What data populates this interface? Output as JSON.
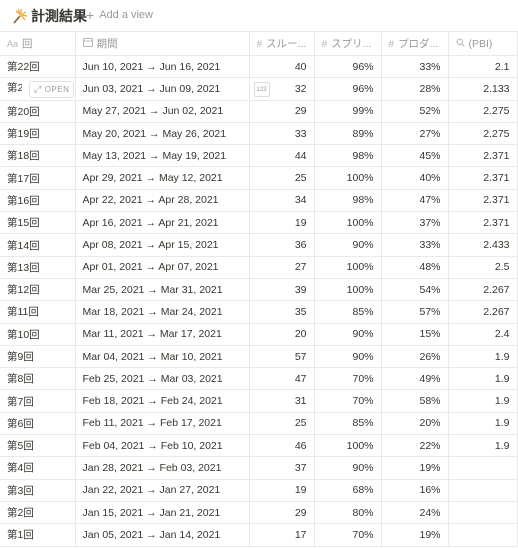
{
  "database": {
    "title": "計測結果",
    "icon": "sparkler-icon",
    "add_view_label": "Add a view"
  },
  "columns": [
    {
      "label": "回",
      "icon": "title-aa-icon"
    },
    {
      "label": "期間",
      "icon": "calendar-icon"
    },
    {
      "label": "スルー...",
      "icon": "number-hash-icon"
    },
    {
      "label": "スプリ...",
      "icon": "number-hash-icon"
    },
    {
      "label": "プロダ...",
      "icon": "number-hash-icon"
    },
    {
      "label": "(PBI)",
      "icon": "formula-search-icon"
    }
  ],
  "hover_row": {
    "open_label": "OPEN",
    "badge_label": "123"
  },
  "rows": [
    {
      "name": "第22回",
      "period": "Jun 10, 2021 → Jun 16, 2021",
      "throughput": "40",
      "sprint": "96%",
      "product": "33%",
      "pbi": "2.1"
    },
    {
      "name": "第21回",
      "period": "Jun 03, 2021 → Jun 09, 2021",
      "throughput": "32",
      "sprint": "96%",
      "product": "28%",
      "pbi": "2.133"
    },
    {
      "name": "第20回",
      "period": "May 27, 2021 → Jun 02, 2021",
      "throughput": "29",
      "sprint": "99%",
      "product": "52%",
      "pbi": "2.275"
    },
    {
      "name": "第19回",
      "period": "May 20, 2021 → May 26, 2021",
      "throughput": "33",
      "sprint": "89%",
      "product": "27%",
      "pbi": "2.275"
    },
    {
      "name": "第18回",
      "period": "May 13, 2021 → May 19, 2021",
      "throughput": "44",
      "sprint": "98%",
      "product": "45%",
      "pbi": "2.371"
    },
    {
      "name": "第17回",
      "period": "Apr 29, 2021 → May 12, 2021",
      "throughput": "25",
      "sprint": "100%",
      "product": "40%",
      "pbi": "2.371"
    },
    {
      "name": "第16回",
      "period": "Apr 22, 2021 → Apr 28, 2021",
      "throughput": "34",
      "sprint": "98%",
      "product": "47%",
      "pbi": "2.371"
    },
    {
      "name": "第15回",
      "period": "Apr 16, 2021 → Apr 21, 2021",
      "throughput": "19",
      "sprint": "100%",
      "product": "37%",
      "pbi": "2.371"
    },
    {
      "name": "第14回",
      "period": "Apr 08, 2021 → Apr 15, 2021",
      "throughput": "36",
      "sprint": "90%",
      "product": "33%",
      "pbi": "2.433"
    },
    {
      "name": "第13回",
      "period": "Apr 01, 2021 → Apr 07, 2021",
      "throughput": "27",
      "sprint": "100%",
      "product": "48%",
      "pbi": "2.5"
    },
    {
      "name": "第12回",
      "period": "Mar 25, 2021 → Mar 31, 2021",
      "throughput": "39",
      "sprint": "100%",
      "product": "54%",
      "pbi": "2.267"
    },
    {
      "name": "第11回",
      "period": "Mar 18, 2021 → Mar 24, 2021",
      "throughput": "35",
      "sprint": "85%",
      "product": "57%",
      "pbi": "2.267"
    },
    {
      "name": "第10回",
      "period": "Mar 11, 2021 → Mar 17, 2021",
      "throughput": "20",
      "sprint": "90%",
      "product": "15%",
      "pbi": "2.4"
    },
    {
      "name": "第9回",
      "period": "Mar 04, 2021 → Mar 10, 2021",
      "throughput": "57",
      "sprint": "90%",
      "product": "26%",
      "pbi": "1.9"
    },
    {
      "name": "第8回",
      "period": "Feb 25, 2021 → Mar 03, 2021",
      "throughput": "47",
      "sprint": "70%",
      "product": "49%",
      "pbi": "1.9"
    },
    {
      "name": "第7回",
      "period": "Feb 18, 2021 → Feb 24, 2021",
      "throughput": "31",
      "sprint": "70%",
      "product": "58%",
      "pbi": "1.9"
    },
    {
      "name": "第6回",
      "period": "Feb 11, 2021 → Feb 17, 2021",
      "throughput": "25",
      "sprint": "85%",
      "product": "20%",
      "pbi": "1.9"
    },
    {
      "name": "第5回",
      "period": "Feb 04, 2021 → Feb 10, 2021",
      "throughput": "46",
      "sprint": "100%",
      "product": "22%",
      "pbi": "1.9"
    },
    {
      "name": "第4回",
      "period": "Jan 28, 2021 → Feb 03, 2021",
      "throughput": "37",
      "sprint": "90%",
      "product": "19%",
      "pbi": ""
    },
    {
      "name": "第3回",
      "period": "Jan 22, 2021 → Jan 27, 2021",
      "throughput": "19",
      "sprint": "68%",
      "product": "16%",
      "pbi": ""
    },
    {
      "name": "第2回",
      "period": "Jan 15, 2021 → Jan 21, 2021",
      "throughput": "29",
      "sprint": "80%",
      "product": "24%",
      "pbi": ""
    },
    {
      "name": "第1回",
      "period": "Jan 05, 2021 → Jan 14, 2021",
      "throughput": "17",
      "sprint": "70%",
      "product": "19%",
      "pbi": ""
    }
  ],
  "colors": {
    "text": "#37352f",
    "muted": "#9b9a97",
    "border": "#e9e9e7"
  }
}
